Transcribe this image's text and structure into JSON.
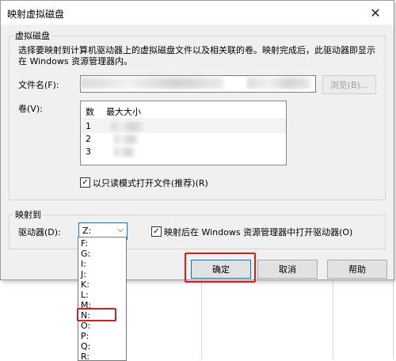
{
  "dialog": {
    "title": "映射虚拟磁盘",
    "close_glyph": "✕"
  },
  "virtual_disk": {
    "group_title": "虚拟磁盘",
    "description": "选择要映射到计算机驱动器上的虚拟磁盘文件以及相关联的卷。映射完成后，此驱动器即显示在 Windows 资源管理器内。",
    "filename_label": "文件名(F):",
    "filename_value": "",
    "browse_label": "浏览(B)...",
    "volume_label": "卷(V):",
    "volume_columns": [
      "数",
      "最大大小"
    ],
    "volume_rows": [
      {
        "num": "1",
        "size": ""
      },
      {
        "num": "2",
        "size": ""
      },
      {
        "num": "3",
        "size": ""
      }
    ],
    "readonly_checked": true,
    "readonly_label": "以只读模式打开文件(推荐)(R)"
  },
  "mapping": {
    "group_title": "映射到",
    "drive_label": "驱动器(D):",
    "drive_value": "Z:",
    "open_explorer_checked": true,
    "open_explorer_label": "映射后在 Windows 资源管理器中打开驱动器(O)"
  },
  "dropdown_options": [
    "F:",
    "G:",
    "I:",
    "J:",
    "K:",
    "L:",
    "M:",
    "N:",
    "O:",
    "P:",
    "Q:",
    "R:"
  ],
  "buttons": {
    "ok": "确定",
    "cancel": "取消",
    "help": "帮助"
  },
  "highlight_color": "#e0191a"
}
